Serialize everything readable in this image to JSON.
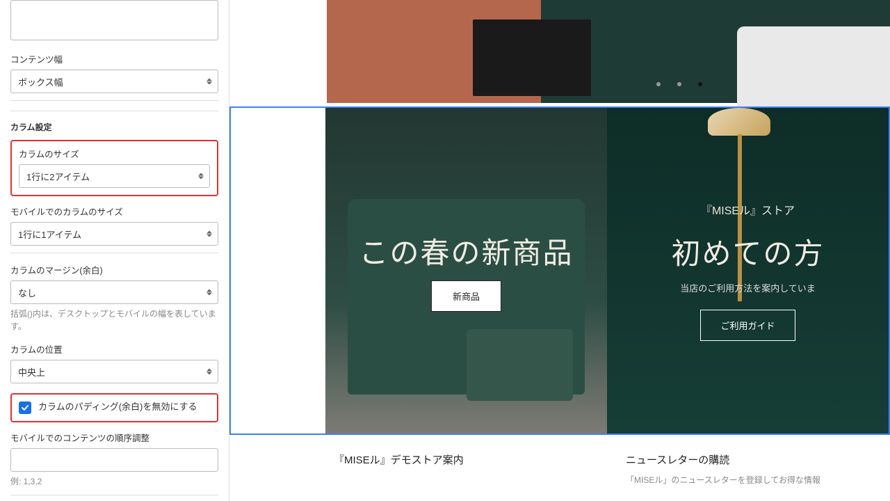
{
  "sidebar": {
    "content_width": {
      "label": "コンテンツ幅",
      "value": "ボックス幅"
    },
    "column_section": "カラム設定",
    "column_size": {
      "label": "カラムのサイズ",
      "value": "1行に2アイテム"
    },
    "mobile_column_size": {
      "label": "モバイルでのカラムのサイズ",
      "value": "1行に1アイテム"
    },
    "column_margin": {
      "label": "カラムのマージン(余白)",
      "value": "なし",
      "help": "括弧()内は、デスクトップとモバイルの幅を表しています。"
    },
    "column_position": {
      "label": "カラムの位置",
      "value": "中央上"
    },
    "disable_padding": {
      "label": "カラムのパディング(余白)を無効にする",
      "checked": true
    },
    "mobile_order": {
      "label": "モバイルでのコンテンツの順序調整",
      "help": "例: 1,3,2"
    }
  },
  "preview": {
    "banner_left": {
      "title": "この春の新商品",
      "button": "新商品"
    },
    "banner_right": {
      "eyebrow": "『MISEル』ストア",
      "title": "初めての方",
      "sub": "当店のご利用方法を案内していま",
      "button": "ご利用ガイド"
    },
    "body_left_title": "『MISEル』デモストア案内",
    "body_right_title": "ニュースレターの購読",
    "body_right_sub": "「MISEル」のニュースレターを登録してお得な情報"
  }
}
